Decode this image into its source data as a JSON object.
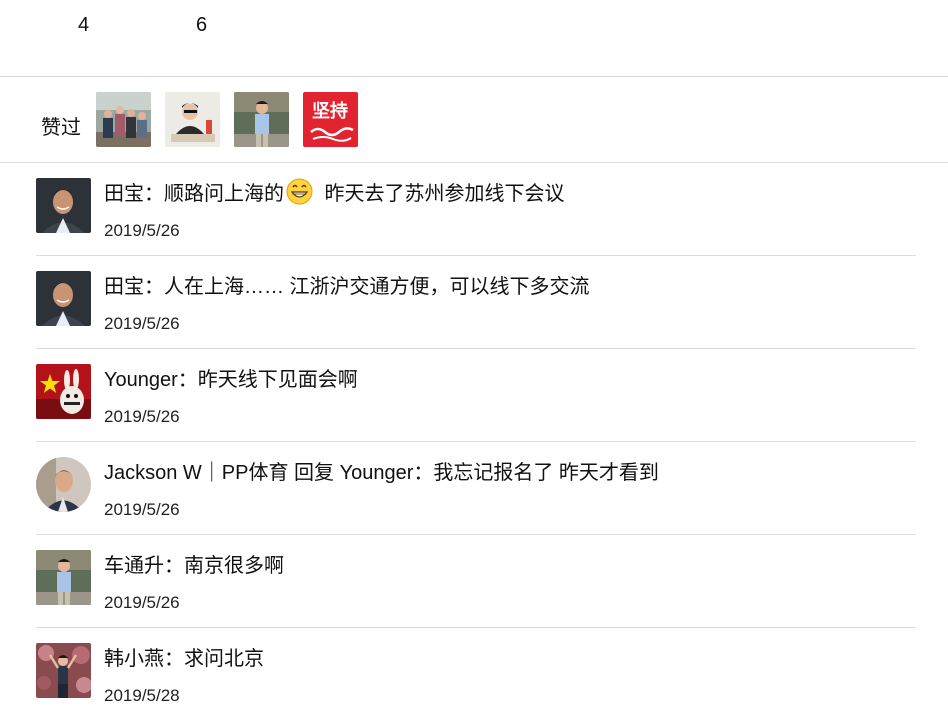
{
  "stats": {
    "count1": "4",
    "count2": "6"
  },
  "likes": {
    "label": "赞过",
    "avatars": [
      {
        "icon": "group-photo-avatar"
      },
      {
        "icon": "person-at-desk-avatar"
      },
      {
        "icon": "man-standing-avatar"
      },
      {
        "icon": "red-calligraphy-avatar",
        "text": "坚持"
      }
    ]
  },
  "comments": [
    {
      "author": "田宝",
      "text": "顺路问上海的",
      "emoji": "grinning-emoji",
      "text_after": " 昨天去了苏州参加线下会议",
      "date": "2019/5/26"
    },
    {
      "author": "田宝",
      "text": "人在上海…… 江浙沪交通方便，可以线下多交流",
      "date": "2019/5/26"
    },
    {
      "author": "Younger",
      "text": "昨天线下见面会啊",
      "date": "2019/5/26"
    },
    {
      "author": "Jackson W｜PP体育 回复 Younger",
      "text": "我忘记报名了  昨天才看到",
      "date": "2019/5/26"
    },
    {
      "author": "车通升",
      "text": "南京很多啊",
      "date": "2019/5/26"
    },
    {
      "author": "韩小燕",
      "text": "求问北京",
      "date": "2019/5/28"
    }
  ]
}
